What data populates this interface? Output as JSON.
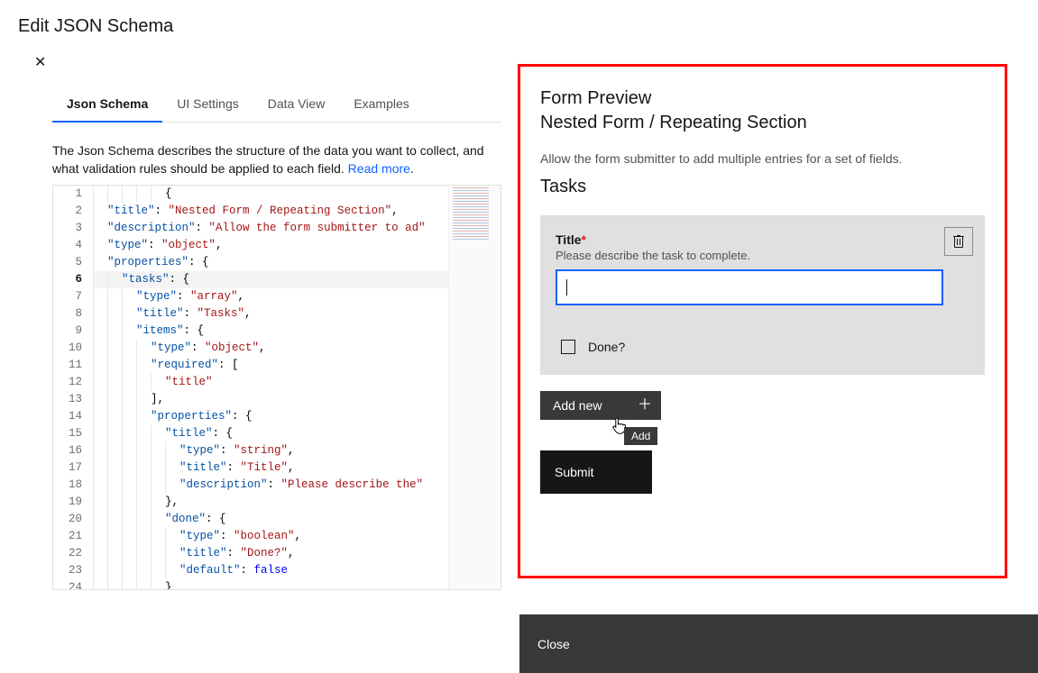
{
  "header": {
    "title": "Edit JSON Schema"
  },
  "tabs": [
    {
      "label": "Json Schema",
      "active": true
    },
    {
      "label": "UI Settings",
      "active": false
    },
    {
      "label": "Data View",
      "active": false
    },
    {
      "label": "Examples",
      "active": false
    }
  ],
  "tab_description": {
    "text": "The Json Schema describes the structure of the data you want to collect, and what validation rules should be applied to each field. ",
    "link_text": "Read more",
    "suffix": "."
  },
  "editor": {
    "line_numbers": [
      "1",
      "2",
      "3",
      "4",
      "5",
      "6",
      "7",
      "8",
      "9",
      "10",
      "11",
      "12",
      "13",
      "14",
      "15",
      "16",
      "17",
      "18",
      "19",
      "20",
      "21",
      "22",
      "23",
      "24"
    ],
    "active_line": 6,
    "schema": {
      "title": "Nested Form / Repeating Section",
      "description": "Allow the form submitter to ad",
      "type": "object",
      "properties": {
        "tasks": {
          "type": "array",
          "title": "Tasks",
          "items": {
            "type": "object",
            "required": [
              "title"
            ],
            "properties": {
              "title": {
                "type": "string",
                "title": "Title",
                "description": "Please describe the"
              },
              "done": {
                "type": "boolean",
                "title": "Done?",
                "default": false
              }
            }
          }
        }
      }
    }
  },
  "preview": {
    "heading": "Form Preview",
    "form_title": "Nested Form / Repeating Section",
    "form_description": "Allow the form submitter to add multiple entries for a set of fields.",
    "section_title": "Tasks",
    "task": {
      "title_label": "Title",
      "title_help": "Please describe the task to complete.",
      "done_label": "Done?"
    },
    "add_new_label": "Add new",
    "add_tooltip": "Add",
    "submit_label": "Submit"
  },
  "footer": {
    "close_label": "Close"
  }
}
